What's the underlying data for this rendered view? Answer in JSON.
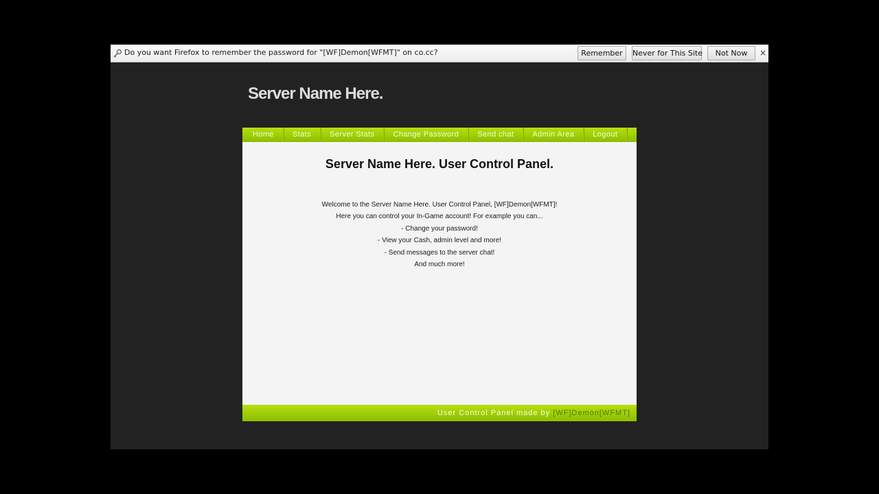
{
  "notification": {
    "icon": "key-icon",
    "message": "Do you want Firefox to remember the password for \"[WF]Demon[WFMT]\" on co.cc?",
    "remember_label": "Remember",
    "never_label": "Never for This Site",
    "not_now_label": "Not Now",
    "close_label": "×"
  },
  "site": {
    "title": "Server Name Here."
  },
  "nav": {
    "items": [
      {
        "label": "Home"
      },
      {
        "label": "Stats"
      },
      {
        "label": "Server Stats"
      },
      {
        "label": "Change Password"
      },
      {
        "label": "Send chat"
      },
      {
        "label": "Admin Area"
      },
      {
        "label": "Logout"
      }
    ]
  },
  "main": {
    "heading": "Server Name Here. User Control Panel.",
    "lines": [
      "Welcome to the Server Name Here. User Control Panel, [WF]Demon[WFMT]!",
      "Here you can control your In-Game account! For example you can...",
      "- Change your password!",
      "- View your Cash, admin level and more!",
      "- Send messages to the server chat!",
      "And much more!"
    ]
  },
  "footer": {
    "prefix": "User Control Panel made by ",
    "author": "[WF]Demon[WFMT]"
  },
  "colors": {
    "accent": "#9bcc00",
    "page_background": "#222222",
    "panel_background": "#f4f4f4"
  }
}
